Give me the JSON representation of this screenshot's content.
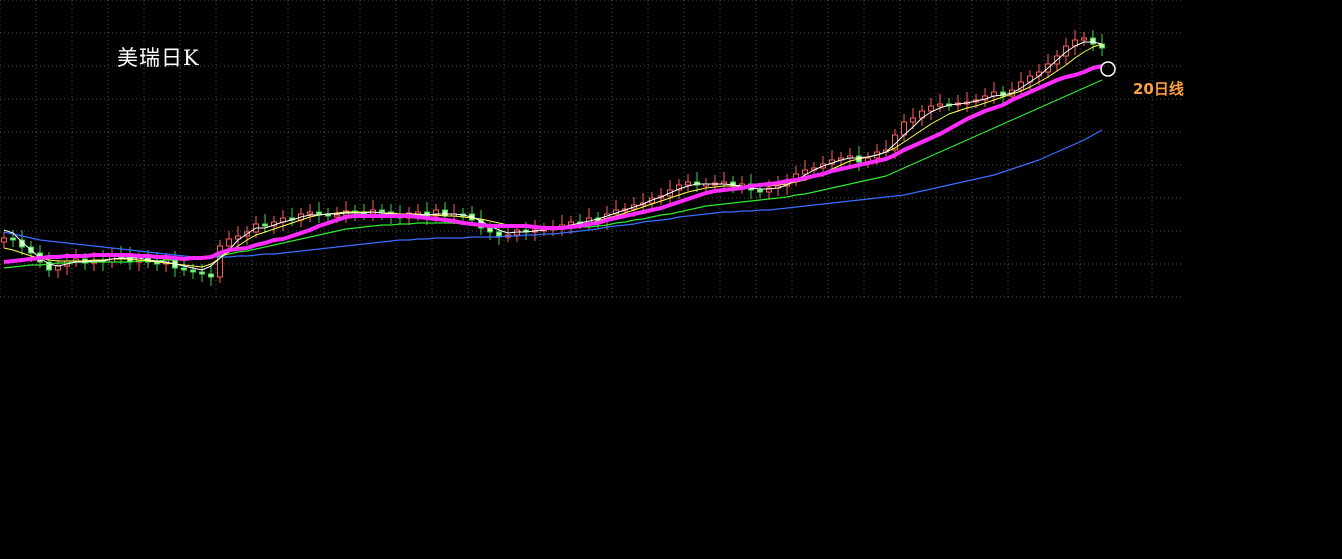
{
  "title": "美瑞日K",
  "annotation": "20日线",
  "colors": {
    "background": "#000000",
    "grid": "#6a6a6a",
    "up_candle": "#ff5b5b",
    "down_candle": "#3fd24a",
    "candle_up_fill": "#000000",
    "candle_down_fill": "#bfffb0",
    "ma5": "#ffffff",
    "ma10": "#ffff55",
    "ma20": "#ff2bff",
    "ma30": "#30e830",
    "ma60": "#3b6dff",
    "annotation_text": "#ff9f3f",
    "marker": "#ffffff"
  },
  "chart_data": {
    "type": "line",
    "grid": true,
    "x": [
      0,
      9,
      18,
      27,
      36,
      45,
      54,
      63,
      72,
      81,
      90,
      99,
      108,
      117,
      126,
      135,
      144,
      153,
      162,
      171,
      180,
      189,
      198,
      207,
      216,
      225,
      234,
      243,
      252,
      261,
      270,
      279,
      288,
      297,
      306,
      315,
      324,
      333,
      342,
      351,
      360,
      369,
      378,
      387,
      396,
      405,
      414,
      423,
      432,
      441,
      450,
      459,
      468,
      477,
      486,
      495,
      504,
      513,
      522,
      531,
      540,
      549,
      558,
      567,
      576,
      585,
      594,
      603,
      612,
      621,
      630,
      639,
      648,
      657,
      666,
      675,
      684,
      693,
      702,
      711,
      720,
      729,
      738,
      747,
      756,
      765,
      774,
      783,
      792,
      801,
      810,
      819,
      828,
      837,
      846,
      855,
      864,
      873,
      882,
      891,
      900,
      909,
      918,
      927,
      936,
      945,
      954,
      963,
      972,
      981,
      990,
      999,
      1008,
      1017,
      1026,
      1035,
      1044,
      1053,
      1062,
      1071,
      1080,
      1089,
      1098
    ],
    "close": [
      238,
      240,
      247,
      253,
      262,
      270,
      266,
      261,
      259,
      263,
      260,
      262,
      254,
      257,
      262,
      258,
      262,
      264,
      259,
      268,
      270,
      272,
      274,
      277,
      246,
      239,
      236,
      232,
      224,
      226,
      222,
      218,
      220,
      214,
      212,
      214,
      216,
      215,
      211,
      212,
      214,
      210,
      212,
      215,
      218,
      213,
      212,
      216,
      210,
      216,
      214,
      214,
      220,
      228,
      232,
      236,
      235,
      230,
      232,
      230,
      229,
      228,
      225,
      222,
      223,
      218,
      221,
      214,
      210,
      209,
      205,
      203,
      198,
      196,
      190,
      185,
      182,
      185,
      184,
      183,
      182,
      186,
      184,
      190,
      192,
      188,
      186,
      180,
      174,
      170,
      168,
      164,
      160,
      158,
      156,
      162,
      158,
      152,
      150,
      135,
      122,
      118,
      111,
      106,
      104,
      104,
      103,
      102,
      100,
      96,
      92,
      96,
      90,
      82,
      76,
      72,
      64,
      56,
      46,
      40,
      38,
      44,
      48
    ],
    "ma20": [
      262,
      261,
      260,
      259,
      258,
      257,
      257,
      256,
      256,
      256,
      255,
      255,
      255,
      255,
      255,
      256,
      256,
      257,
      257,
      258,
      259,
      258,
      258,
      257,
      253,
      250,
      249,
      248,
      245,
      243,
      240,
      239,
      236,
      233,
      230,
      226,
      223,
      220,
      217,
      216,
      216,
      216,
      216,
      216,
      216,
      216,
      217,
      218,
      219,
      220,
      221,
      223,
      224,
      225,
      226,
      226,
      226,
      226,
      226,
      227,
      228,
      228,
      228,
      227,
      226,
      224,
      223,
      220,
      218,
      216,
      214,
      212,
      210,
      208,
      205,
      202,
      199,
      196,
      193,
      191,
      190,
      189,
      188,
      186,
      185,
      184,
      183,
      181,
      180,
      178,
      176,
      174,
      171,
      169,
      167,
      165,
      163,
      161,
      159,
      155,
      150,
      146,
      142,
      138,
      134,
      129,
      124,
      119,
      115,
      111,
      108,
      105,
      100,
      96,
      92,
      88,
      84,
      80,
      77,
      75,
      72,
      68,
      66
    ],
    "ma5": [
      230,
      233,
      242,
      250,
      258,
      264,
      266,
      264,
      262,
      262,
      261,
      261,
      259,
      258,
      258,
      258,
      260,
      261,
      262,
      264,
      266,
      268,
      270,
      266,
      258,
      250,
      240,
      234,
      228,
      228,
      225,
      222,
      220,
      217,
      215,
      215,
      214,
      214,
      213,
      213,
      213,
      212,
      213,
      214,
      215,
      214,
      215,
      215,
      214,
      214,
      214,
      215,
      217,
      221,
      226,
      230,
      233,
      232,
      232,
      231,
      230,
      229,
      227,
      225,
      223,
      221,
      219,
      216,
      213,
      210,
      207,
      204,
      200,
      197,
      193,
      189,
      186,
      184,
      184,
      184,
      184,
      185,
      186,
      188,
      189,
      189,
      188,
      185,
      180,
      175,
      170,
      166,
      163,
      160,
      158,
      158,
      157,
      155,
      152,
      144,
      135,
      127,
      118,
      112,
      108,
      105,
      104,
      103,
      101,
      99,
      96,
      95,
      93,
      88,
      82,
      76,
      68,
      60,
      52,
      46,
      42,
      42,
      44
    ],
    "ma10": [
      248,
      250,
      253,
      256,
      258,
      260,
      261,
      261,
      261,
      261,
      260,
      260,
      259,
      259,
      259,
      260,
      261,
      262,
      263,
      264,
      265,
      266,
      267,
      264,
      258,
      252,
      246,
      240,
      235,
      232,
      229,
      226,
      223,
      220,
      217,
      215,
      214,
      213,
      212,
      212,
      212,
      212,
      213,
      213,
      214,
      214,
      214,
      215,
      215,
      216,
      216,
      217,
      218,
      219,
      221,
      223,
      225,
      226,
      227,
      228,
      228,
      228,
      227,
      226,
      225,
      223,
      221,
      218,
      216,
      213,
      210,
      207,
      204,
      201,
      198,
      195,
      192,
      190,
      188,
      187,
      186,
      186,
      186,
      186,
      186,
      186,
      185,
      184,
      182,
      180,
      177,
      173,
      169,
      165,
      161,
      159,
      157,
      155,
      152,
      148,
      142,
      136,
      130,
      124,
      119,
      114,
      111,
      108,
      106,
      103,
      100,
      97,
      94,
      91,
      87,
      82,
      77,
      71,
      65,
      58,
      52,
      47,
      44
    ],
    "ma30": [
      268,
      267,
      266,
      265,
      265,
      264,
      263,
      263,
      262,
      262,
      262,
      262,
      262,
      262,
      262,
      261,
      261,
      261,
      260,
      260,
      259,
      258,
      258,
      257,
      256,
      254,
      252,
      251,
      249,
      247,
      245,
      243,
      241,
      239,
      237,
      235,
      233,
      231,
      229,
      228,
      227,
      226,
      225,
      225,
      224,
      224,
      223,
      223,
      223,
      223,
      223,
      224,
      224,
      225,
      225,
      226,
      226,
      227,
      227,
      227,
      228,
      228,
      228,
      228,
      227,
      227,
      226,
      225,
      223,
      222,
      220,
      219,
      217,
      215,
      214,
      212,
      210,
      208,
      206,
      205,
      204,
      203,
      202,
      201,
      200,
      199,
      198,
      197,
      195,
      194,
      192,
      190,
      188,
      186,
      184,
      182,
      180,
      178,
      176,
      172,
      168,
      164,
      160,
      156,
      152,
      148,
      144,
      140,
      136,
      132,
      128,
      124,
      120,
      116,
      112,
      108,
      104,
      100,
      96,
      92,
      88,
      84,
      80
    ],
    "ma60": [
      232,
      234,
      236,
      238,
      240,
      241,
      242,
      243,
      244,
      245,
      246,
      247,
      248,
      249,
      250,
      251,
      252,
      253,
      254,
      255,
      256,
      257,
      257,
      257,
      257,
      257,
      256,
      256,
      255,
      254,
      254,
      253,
      252,
      251,
      250,
      249,
      248,
      247,
      246,
      245,
      244,
      243,
      242,
      241,
      240,
      240,
      239,
      239,
      238,
      238,
      238,
      238,
      237,
      237,
      237,
      237,
      236,
      236,
      235,
      235,
      234,
      234,
      233,
      232,
      231,
      230,
      229,
      227,
      226,
      225,
      224,
      222,
      221,
      220,
      219,
      217,
      216,
      215,
      214,
      213,
      212,
      212,
      211,
      211,
      210,
      210,
      209,
      208,
      207,
      206,
      205,
      204,
      203,
      202,
      201,
      200,
      199,
      198,
      197,
      196,
      195,
      193,
      191,
      189,
      187,
      185,
      183,
      181,
      179,
      177,
      175,
      172,
      169,
      166,
      163,
      160,
      156,
      152,
      148,
      144,
      140,
      135,
      130
    ],
    "legend": "none"
  }
}
